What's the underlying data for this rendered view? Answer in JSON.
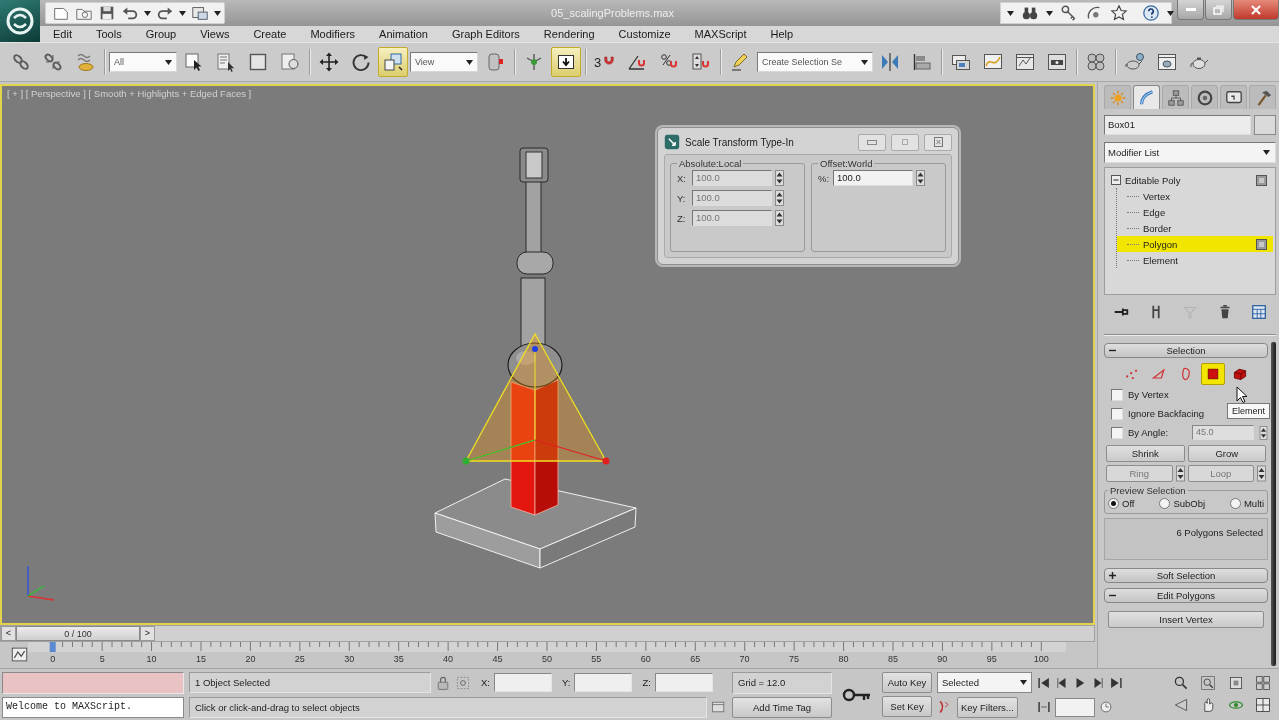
{
  "title_bar": {
    "title": "05_scalingProblems.max"
  },
  "menu_bar": [
    "Edit",
    "Tools",
    "Group",
    "Views",
    "Create",
    "Modifiers",
    "Animation",
    "Graph Editors",
    "Rendering",
    "Customize",
    "MAXScript",
    "Help"
  ],
  "main_toolbar": [
    {
      "kind": "tool",
      "selected": false
    },
    {
      "kind": "tool",
      "selected": false
    },
    {
      "kind": "tool",
      "selected": false
    },
    {
      "kind": "separator"
    },
    {
      "kind": "dropdown",
      "value": "All"
    },
    {
      "kind": "tool",
      "selected": false
    },
    {
      "kind": "tool",
      "selected": false
    },
    {
      "kind": "tool",
      "selected": false
    },
    {
      "kind": "tool",
      "selected": false
    },
    {
      "kind": "separator"
    },
    {
      "kind": "tool",
      "selected": false
    },
    {
      "kind": "tool",
      "selected": false
    },
    {
      "kind": "tool",
      "selected": true
    },
    {
      "kind": "dropdown",
      "value": "View"
    },
    {
      "kind": "tool",
      "selected": false
    },
    {
      "kind": "separator"
    },
    {
      "kind": "tool",
      "selected": false
    },
    {
      "kind": "tool",
      "selected": true
    },
    {
      "kind": "separator"
    },
    {
      "kind": "tool",
      "selected": false,
      "label": "3"
    },
    {
      "kind": "tool",
      "selected": false
    },
    {
      "kind": "tool",
      "selected": false
    },
    {
      "kind": "tool",
      "selected": false
    },
    {
      "kind": "separator"
    },
    {
      "kind": "tool",
      "selected": false
    },
    {
      "kind": "dropdown",
      "value": "Create Selection Se"
    },
    {
      "kind": "tool",
      "selected": false
    },
    {
      "kind": "tool",
      "selected": false
    },
    {
      "kind": "separator"
    },
    {
      "kind": "tool",
      "selected": false
    },
    {
      "kind": "tool",
      "selected": false
    },
    {
      "kind": "tool",
      "selected": false
    },
    {
      "kind": "tool",
      "selected": false
    },
    {
      "kind": "separator"
    },
    {
      "kind": "tool",
      "selected": false
    },
    {
      "kind": "separator"
    },
    {
      "kind": "tool",
      "selected": false
    },
    {
      "kind": "tool",
      "selected": false
    },
    {
      "kind": "tool",
      "selected": false
    }
  ],
  "viewport": {
    "label": "[ + ] [ Perspective ] [ Smooth + Highlights + Edged Faces ]"
  },
  "scale_dialog": {
    "title": "Scale Transform Type-In",
    "groups": [
      {
        "title": "Absolute:Local",
        "fields": [
          {
            "label": "X:",
            "value": "100.0",
            "disabled": true
          },
          {
            "label": "Y:",
            "value": "100.0",
            "disabled": true
          },
          {
            "label": "Z:",
            "value": "100.0",
            "disabled": true
          }
        ]
      },
      {
        "title": "Offset:World",
        "fields": [
          {
            "label": "%:",
            "value": "100.0",
            "disabled": false
          }
        ]
      }
    ]
  },
  "command_panel": {
    "tabs": [
      {
        "selected": false
      },
      {
        "selected": true
      },
      {
        "selected": false
      },
      {
        "selected": false
      },
      {
        "selected": false
      },
      {
        "selected": false
      }
    ],
    "object_name": "Box01",
    "modifier_list": "Modifier List",
    "modifier_stack": [
      {
        "label": "Editable Poly",
        "expanded": true,
        "selected": false,
        "children": [
          {
            "label": "Vertex",
            "selected": false
          },
          {
            "label": "Edge",
            "selected": false
          },
          {
            "label": "Border",
            "selected": false
          },
          {
            "label": "Polygon",
            "selected": true
          },
          {
            "label": "Element",
            "selected": false
          }
        ]
      }
    ],
    "stack_tools": [
      {
        "disabled": false
      },
      {
        "disabled": false
      },
      {
        "disabled": true
      },
      {
        "disabled": false
      },
      {
        "disabled": false
      }
    ],
    "selection": {
      "title": "Selection",
      "expanded": true,
      "subobjects": [
        {
          "selected": false
        },
        {
          "selected": false
        },
        {
          "selected": false
        },
        {
          "selected": true
        },
        {
          "selected": false
        }
      ],
      "options": [
        {
          "label": "By Vertex",
          "checked": false
        },
        {
          "label": "Ignore Backfacing",
          "checked": false
        },
        {
          "label": "By Angle:",
          "checked": false,
          "value": "45.0"
        }
      ],
      "buttons": [
        {
          "label": "Shrink",
          "disabled": false
        },
        {
          "label": "Grow",
          "disabled": false
        },
        {
          "label": "Ring",
          "disabled": true
        },
        {
          "label": "Loop",
          "disabled": true
        }
      ],
      "preview": {
        "title": "Preview Selection",
        "options": [
          {
            "label": "Off",
            "selected": true
          },
          {
            "label": "SubObj",
            "selected": false
          },
          {
            "label": "Multi",
            "selected": false
          }
        ]
      },
      "status": "6 Polygons Selected"
    },
    "rollouts": [
      {
        "title": "Soft Selection",
        "expanded": false
      },
      {
        "title": "Edit Polygons",
        "expanded": true,
        "buttons": [
          "Insert Vertex"
        ]
      }
    ],
    "tooltip": "Element"
  },
  "time_slider": {
    "prev": "<",
    "position": "0 / 100",
    "next": ">",
    "level": 0
  },
  "track_bar": {
    "ticks": [
      "0",
      "5",
      "10",
      "15",
      "20",
      "25",
      "30",
      "35",
      "40",
      "45",
      "50",
      "55",
      "60",
      "65",
      "70",
      "75",
      "80",
      "85",
      "90",
      "95",
      "100"
    ]
  },
  "status_bar": {
    "maxscript_output": "Welcome to MAXScript.",
    "selection": "1 Object Selected",
    "prompt": "Click or click-and-drag to select objects",
    "coords": [
      "X:",
      "Y:",
      "Z:"
    ],
    "grid": "Grid = 12.0",
    "add_time_tag": "Add Time Tag",
    "auto_key": "Auto Key",
    "set_key": "Set Key",
    "key_mode": "Selected",
    "key_filters": "Key Filters..."
  }
}
